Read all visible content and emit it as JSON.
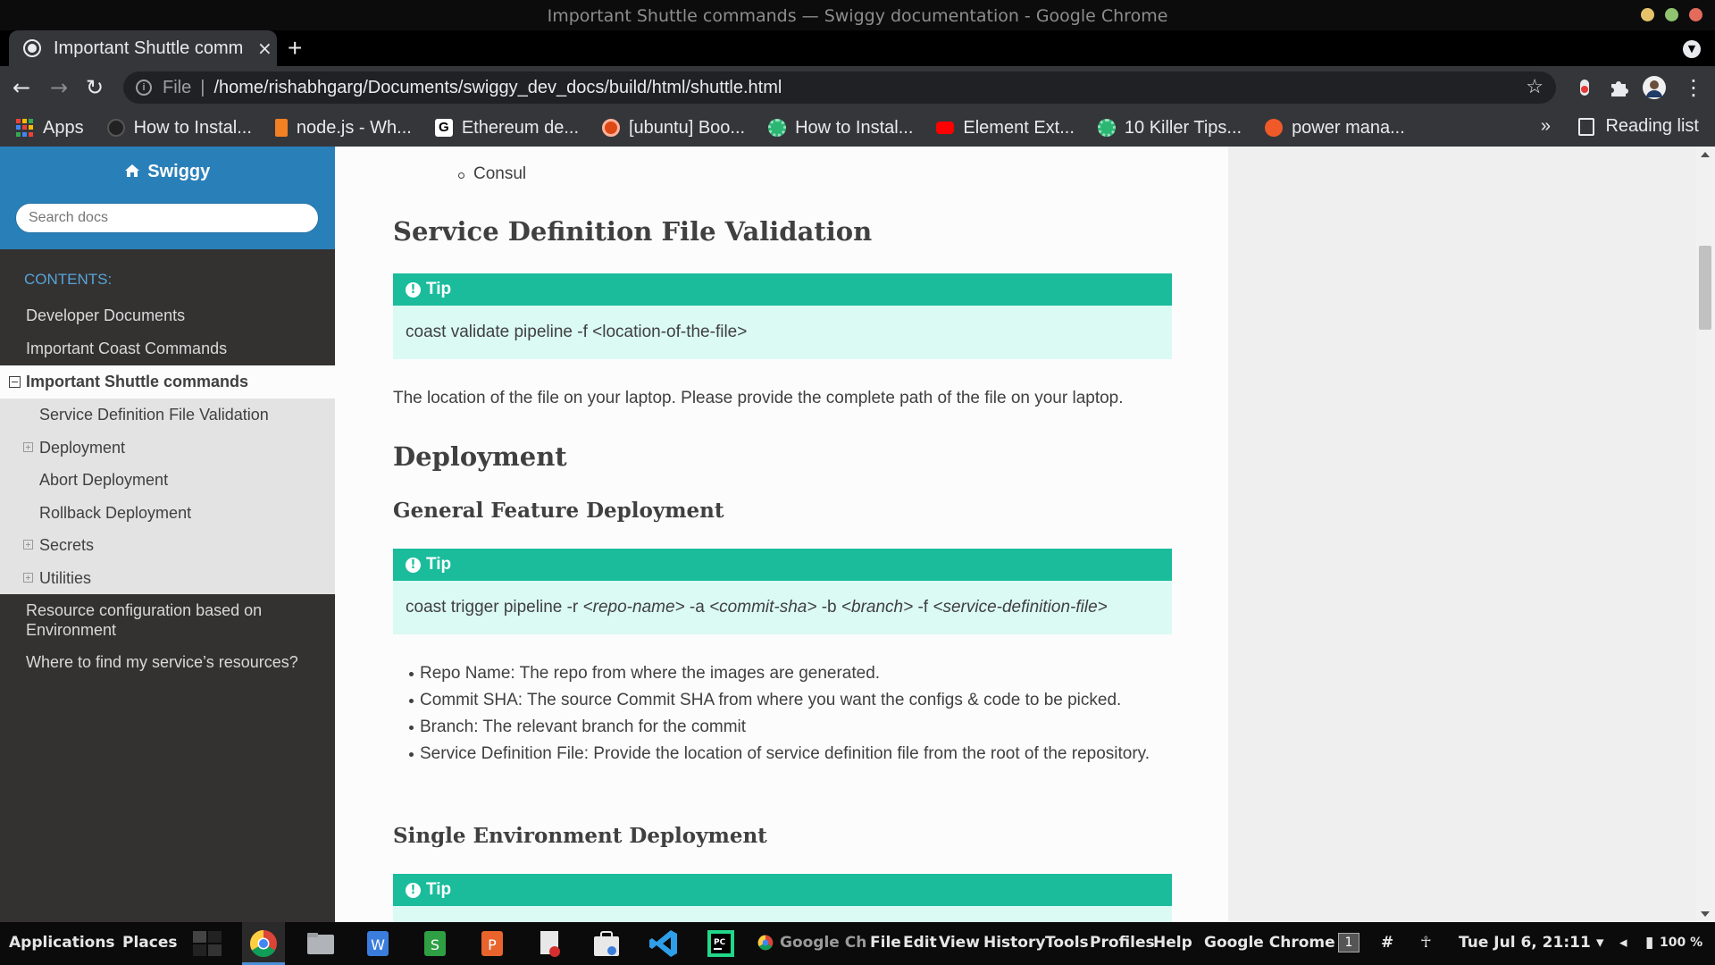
{
  "window": {
    "title": "Important Shuttle commands — Swiggy documentation - Google Chrome"
  },
  "tab": {
    "title": "Important Shuttle comm",
    "close": "×",
    "new_tab": "+"
  },
  "toolbar": {
    "back": "←",
    "forward": "→",
    "reload": "↻",
    "scheme_label": "File",
    "separator": "|",
    "url": "/home/rishabhgarg/Documents/swiggy_dev_docs/build/html/shuttle.html",
    "star": "☆",
    "menu": "⋮"
  },
  "bookmarks": {
    "apps": "Apps",
    "items": [
      {
        "label": "How to Instal...",
        "color": "#222222"
      },
      {
        "label": "node.js - Wh...",
        "color": "#f48024"
      },
      {
        "label": "Ethereum de...",
        "color": "#ffffff"
      },
      {
        "label": "[ubuntu] Boo...",
        "color": "#dd4814"
      },
      {
        "label": "How to Instal...",
        "color": "#2bb673"
      },
      {
        "label": "Element Ext...",
        "color": "#ff0000"
      },
      {
        "label": "10 Killer Tips...",
        "color": "#2bb673"
      },
      {
        "label": "power mana...",
        "color": "#f05a28"
      }
    ],
    "more": "»",
    "reading_list": "Reading list"
  },
  "sidebar": {
    "brand": "Swiggy",
    "search_placeholder": "Search docs",
    "caption": "CONTENTS:",
    "items": [
      {
        "label": "Developer Documents"
      },
      {
        "label": "Important Coast Commands"
      }
    ],
    "current": "Important Shuttle commands",
    "subitems": [
      {
        "label": "Service Definition File Validation",
        "expandable": false
      },
      {
        "label": "Deployment",
        "expandable": true
      },
      {
        "label": "Abort Deployment",
        "expandable": false
      },
      {
        "label": "Rollback Deployment",
        "expandable": false
      },
      {
        "label": "Secrets",
        "expandable": true
      },
      {
        "label": "Utilities",
        "expandable": true
      }
    ],
    "after_items": [
      {
        "label": "Resource configuration based on Environment"
      },
      {
        "label": "Where to find my service’s resources?"
      }
    ]
  },
  "content": {
    "consul": "Consul",
    "h_validation": "Service Definition File Validation",
    "tip_label": "Tip",
    "tip1_body": "coast validate pipeline -f <location-of-the-file>",
    "para1": "The location of the file on your laptop. Please provide the complete path of the file on your laptop.",
    "h_deployment": "Deployment",
    "h_general": "General Feature Deployment",
    "tip2": {
      "cmd1": "coast trigger pipeline -r ",
      "arg1": "<repo-name>",
      "cmd2": " -a ",
      "arg2": "<commit-sha>",
      "cmd3": " -b ",
      "arg3": "<branch>",
      "cmd4": " -f ",
      "arg4": "<service-definition-file>"
    },
    "bullets": [
      "Repo Name: The repo from where the images are generated.",
      "Commit SHA: The source Commit SHA from where you want the configs & code to be picked.",
      "Branch: The relevant branch for the commit",
      "Service Definition File: Provide the location of service definition file from the root of the repository."
    ],
    "h_single": "Single Environment Deployment"
  },
  "taskbar": {
    "applications": "Applications",
    "places": "Places",
    "chrome_window": "Google Ch",
    "menu": [
      "File",
      "Edit",
      "View",
      "History",
      "Tools",
      "Profiles",
      "Help"
    ],
    "active_app": "Google Chrome",
    "workspace": "1",
    "clock": "Tue Jul  6, 21:11",
    "battery": "100 %"
  },
  "colors": {
    "sidebar_head": "#2980b9",
    "sidebar_bg": "#343131",
    "tip_header": "#1abc9c",
    "tip_body": "#dbfaf4",
    "caption": "#55a5d9"
  }
}
